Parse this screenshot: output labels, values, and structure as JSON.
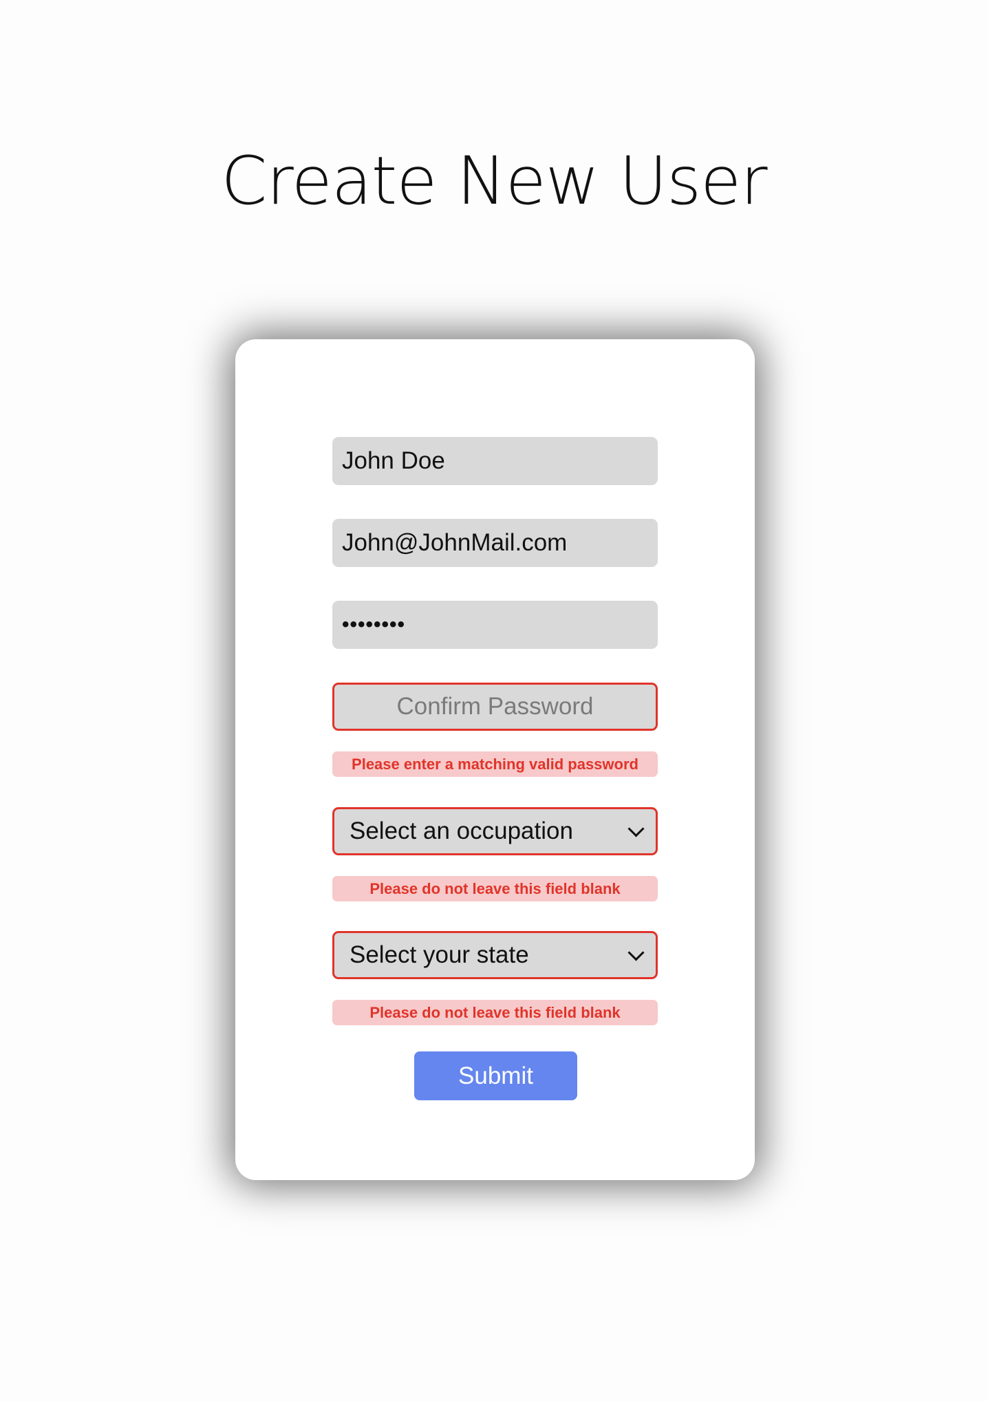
{
  "page": {
    "title": "Create New User"
  },
  "form": {
    "name_value": "John Doe",
    "email_value": "John@JohnMail.com",
    "password_value": "••••••••",
    "confirm_password_placeholder": "Confirm Password",
    "confirm_password_error": "Please enter a matching valid password",
    "occupation_selected": "Select an occupation",
    "occupation_error": "Please do not leave this field blank",
    "state_selected": "Select your state",
    "state_error": "Please do not leave this field blank",
    "submit_label": "Submit"
  },
  "colors": {
    "field_background": "#d9d9d9",
    "error_border": "#e0342a",
    "error_background": "#f7c9ca",
    "submit_background": "#6486ee"
  },
  "icons": {
    "select_arrow": "chevron-down-icon"
  }
}
